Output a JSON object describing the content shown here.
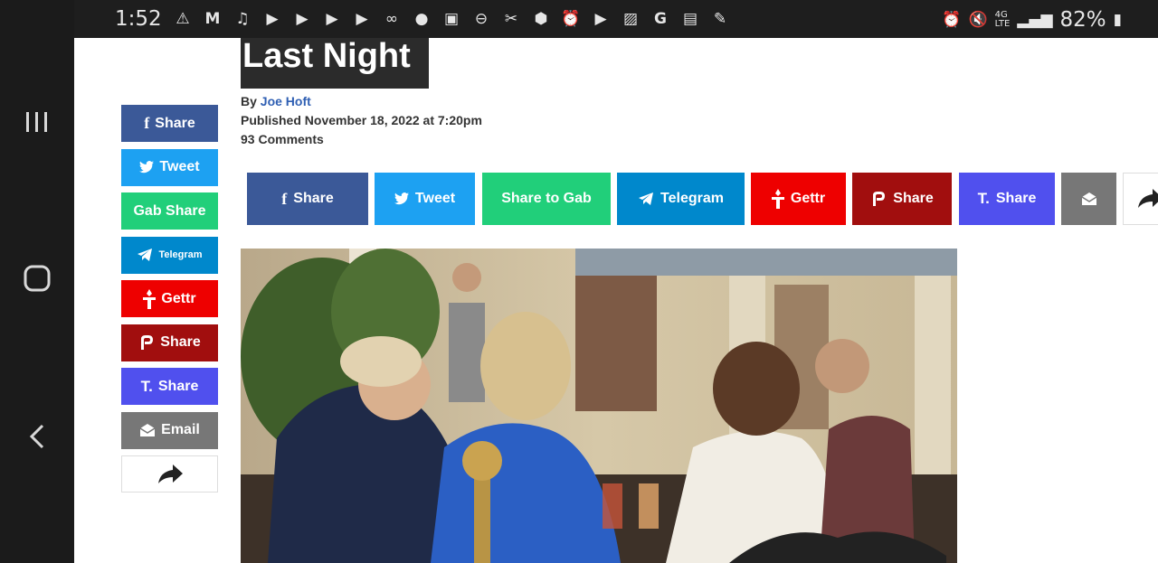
{
  "status_bar": {
    "time": "1:52",
    "battery": "82%",
    "network": "4G LTE"
  },
  "article": {
    "title": "Last Night",
    "byline_prefix": "By",
    "author": "Joe Hoft",
    "published": "Published November 18, 2022 at 7:20pm",
    "comments": "93 Comments"
  },
  "side_share": [
    {
      "label": "Share",
      "color": "#3b5998",
      "icon": "facebook-icon"
    },
    {
      "label": "Tweet",
      "color": "#1da1f2",
      "icon": "twitter-icon"
    },
    {
      "label": "Gab Share",
      "color": "#21cf7a",
      "icon": "gab-icon"
    },
    {
      "label": "Telegram",
      "color": "#0088cc",
      "icon": "telegram-icon"
    },
    {
      "label": "Gettr",
      "color": "#ee0000",
      "icon": "gettr-icon"
    },
    {
      "label": "Share",
      "color": "#a10e0e",
      "icon": "parler-icon"
    },
    {
      "label": "Share",
      "color": "#5050ee",
      "icon": "truth-icon"
    },
    {
      "label": "Email",
      "color": "#777777",
      "icon": "email-icon"
    },
    {
      "label": "",
      "color": "#ffffff",
      "icon": "share-arrow-icon"
    }
  ],
  "top_share": [
    {
      "label": "Share",
      "color": "#3b5998",
      "icon": "facebook-icon"
    },
    {
      "label": "Tweet",
      "color": "#1da1f2",
      "icon": "twitter-icon"
    },
    {
      "label": "Share to Gab",
      "color": "#21cf7a",
      "icon": "gab-icon"
    },
    {
      "label": "Telegram",
      "color": "#0088cc",
      "icon": "telegram-icon"
    },
    {
      "label": "Gettr",
      "color": "#ee0000",
      "icon": "gettr-icon"
    },
    {
      "label": "Share",
      "color": "#a10e0e",
      "icon": "parler-icon"
    },
    {
      "label": "Share",
      "color": "#5050ee",
      "icon": "truth-icon"
    },
    {
      "label": "",
      "color": "#777777",
      "icon": "email-icon"
    },
    {
      "label": "",
      "color": "#ffffff",
      "icon": "share-arrow-icon"
    }
  ]
}
